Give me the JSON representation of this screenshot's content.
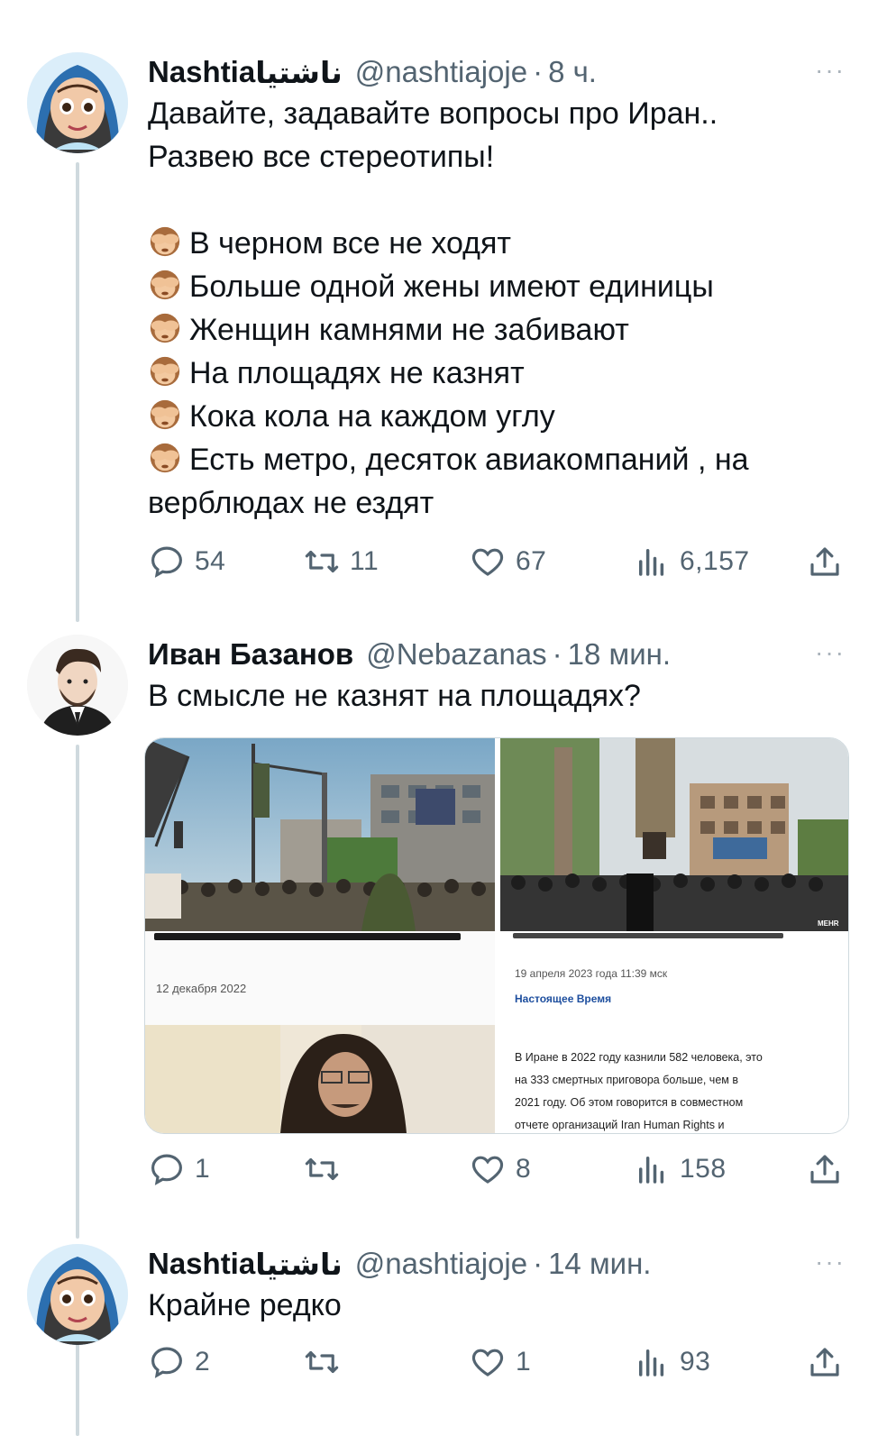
{
  "tweets": [
    {
      "name": "Nashtia",
      "name_persian": "ناشتیا",
      "handle": "@nashtiajoje",
      "time": "8 ч.",
      "more": "···",
      "lines": [
        "Давайте, задавайте вопросы про Иран..",
        "Развею все стереотипы!",
        "",
        "В черном все не ходят",
        "Больше одной жены имеют единицы",
        "Женщин камнями не забивают",
        "На площадях не казнят",
        "Кока кола на каждом углу",
        "Есть метро, десяток авиакомпаний , на",
        "верблюдах не ездят"
      ],
      "replies": "54",
      "retweets": "11",
      "likes": "67",
      "views": "6,157"
    },
    {
      "name": "Иван Базанов",
      "handle": "@Nebazanas",
      "time": "18 мин.",
      "more": "···",
      "text": "В смысле не казнят на площадях?",
      "replies": "1",
      "retweets": "",
      "likes": "8",
      "views": "158",
      "media": {
        "left_date": "12 декабря 2022",
        "right_date": "19 апреля 2023 года 11:39 мск",
        "right_source": "Настоящее Время",
        "right_lines": [
          "В Иране в 2022 году казнили 582 человека, это",
          "на 333 смертных приговора больше, чем в",
          "2021 году. Об этом говорится в совместном",
          "отчете организаций Iran Human Rights и"
        ],
        "watermark": "MEHR"
      }
    },
    {
      "name": "Nashtia",
      "name_persian": "ناشتیا",
      "handle": "@nashtiajoje",
      "time": "14 мин.",
      "more": "···",
      "text": "Крайне редко",
      "replies": "2",
      "retweets": "",
      "likes": "1",
      "views": "93"
    }
  ],
  "separator": "·",
  "icons": [
    "reply-icon",
    "retweet-icon",
    "like-icon",
    "views-icon",
    "share-icon",
    "more-icon",
    "see-no-evil-emoji"
  ],
  "colors": {
    "text": "#0f1419",
    "secondary": "#536471",
    "line": "#cfd9de",
    "link": "#1d4e9e"
  }
}
